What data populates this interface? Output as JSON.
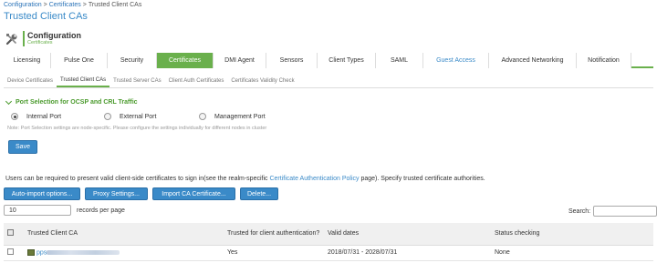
{
  "breadcrumb": {
    "items": [
      "Configuration",
      "Certificates"
    ],
    "current": "Trusted Client CAs",
    "sep": ">"
  },
  "page_title": "Trusted Client CAs",
  "section": {
    "title": "Configuration",
    "subtitle": "Certificates",
    "icon": "tools-icon"
  },
  "main_tabs": {
    "items": [
      {
        "label": "Licensing"
      },
      {
        "label": "Pulse One"
      },
      {
        "label": "Security"
      },
      {
        "label": "Certificates"
      },
      {
        "label": "DMI Agent"
      },
      {
        "label": "Sensors"
      },
      {
        "label": "Client Types"
      },
      {
        "label": "SAML"
      },
      {
        "label": "Guest Access"
      },
      {
        "label": "Advanced Networking"
      },
      {
        "label": "Notification"
      }
    ],
    "active": "Certificates"
  },
  "sub_tabs": {
    "items": [
      {
        "label": "Device Certificates"
      },
      {
        "label": "Trusted Client CAs"
      },
      {
        "label": "Trusted Server CAs"
      },
      {
        "label": "Client Auth Certificates"
      },
      {
        "label": "Certificates Validity Check"
      }
    ],
    "active": "Trusted Client CAs"
  },
  "port_selection": {
    "heading": "Port Selection for OCSP and CRL Traffic",
    "options": [
      {
        "label": "Internal Port",
        "selected": true
      },
      {
        "label": "External Port",
        "selected": false
      },
      {
        "label": "Management Port",
        "selected": false
      }
    ],
    "note": "Note: Port Selection settings are node-specific. Please configure the settings individually for different nodes in cluster",
    "save_label": "Save"
  },
  "description": {
    "before": "Users can be required to present valid client-side certificates to sign in(see the realm-specific ",
    "link": "Certificate Authentication Policy",
    "after": " page). Specify trusted certificate authorities."
  },
  "actions": {
    "auto_import": "Auto-import options...",
    "proxy": "Proxy Settings...",
    "import_ca": "Import CA Certificate...",
    "delete": "Delete..."
  },
  "records": {
    "value": "10",
    "label": "records per page"
  },
  "search": {
    "label": "Search:",
    "value": ""
  },
  "table": {
    "columns": [
      "Trusted Client CA",
      "Trusted for client authentication?",
      "Valid dates",
      "Status checking"
    ],
    "rows": [
      {
        "ca_prefix": "pps",
        "trusted": "Yes",
        "valid": "2018/07/31 - 2028/07/31",
        "status": "None"
      }
    ]
  },
  "colors": {
    "accent_green": "#6ab04c",
    "link_blue": "#3a8ac8",
    "button_blue": "#3a8ac8"
  }
}
